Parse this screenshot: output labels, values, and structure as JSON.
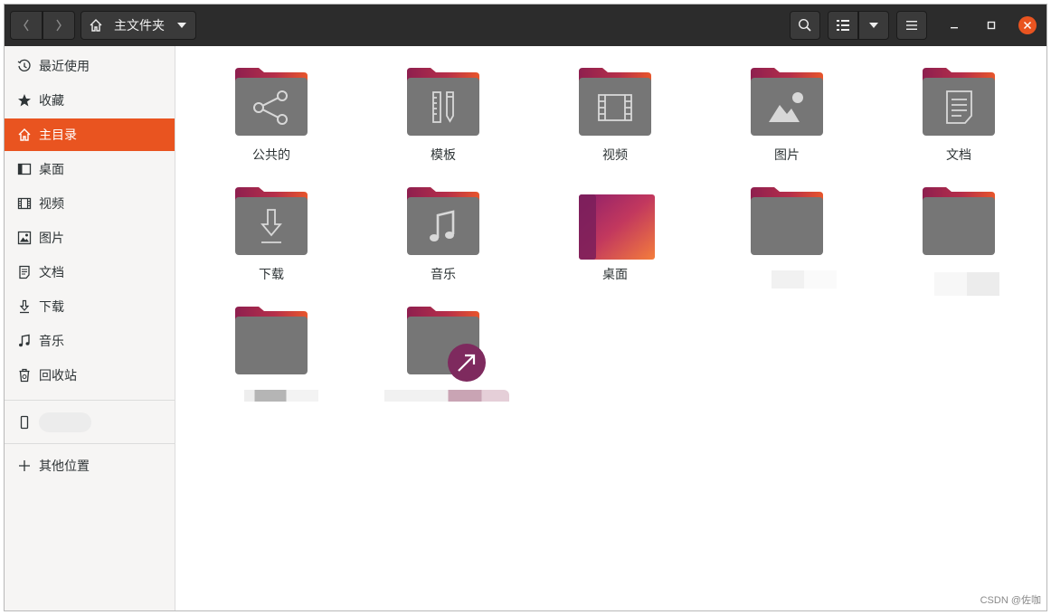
{
  "headerbar": {
    "path_label": "主文件夹"
  },
  "sidebar": {
    "items": [
      {
        "label": "最近使用",
        "icon": "clock-icon"
      },
      {
        "label": "收藏",
        "icon": "star-icon"
      },
      {
        "label": "主目录",
        "icon": "home-icon",
        "active": true
      },
      {
        "label": "桌面",
        "icon": "desktop-icon"
      },
      {
        "label": "视频",
        "icon": "film-icon"
      },
      {
        "label": "图片",
        "icon": "image-icon"
      },
      {
        "label": "文档",
        "icon": "document-icon"
      },
      {
        "label": "下载",
        "icon": "download-icon"
      },
      {
        "label": "音乐",
        "icon": "music-icon"
      },
      {
        "label": "回收站",
        "icon": "trash-icon"
      }
    ],
    "other_locations": "其他位置"
  },
  "files": [
    {
      "name": "公共的",
      "emblem": "share-icon"
    },
    {
      "name": "模板",
      "emblem": "template-icon"
    },
    {
      "name": "视频",
      "emblem": "film-icon"
    },
    {
      "name": "图片",
      "emblem": "image-icon"
    },
    {
      "name": "文档",
      "emblem": "document-icon"
    },
    {
      "name": "下载",
      "emblem": "download-icon"
    },
    {
      "name": "音乐",
      "emblem": "music-icon"
    },
    {
      "name": "桌面",
      "emblem": "desktop-icon"
    }
  ],
  "colors": {
    "accent": "#e95420",
    "headerbar": "#2c2c2c",
    "folder_body": "#767676",
    "folder_tab": "#a1254f"
  },
  "watermark": "CSDN @佐咖"
}
